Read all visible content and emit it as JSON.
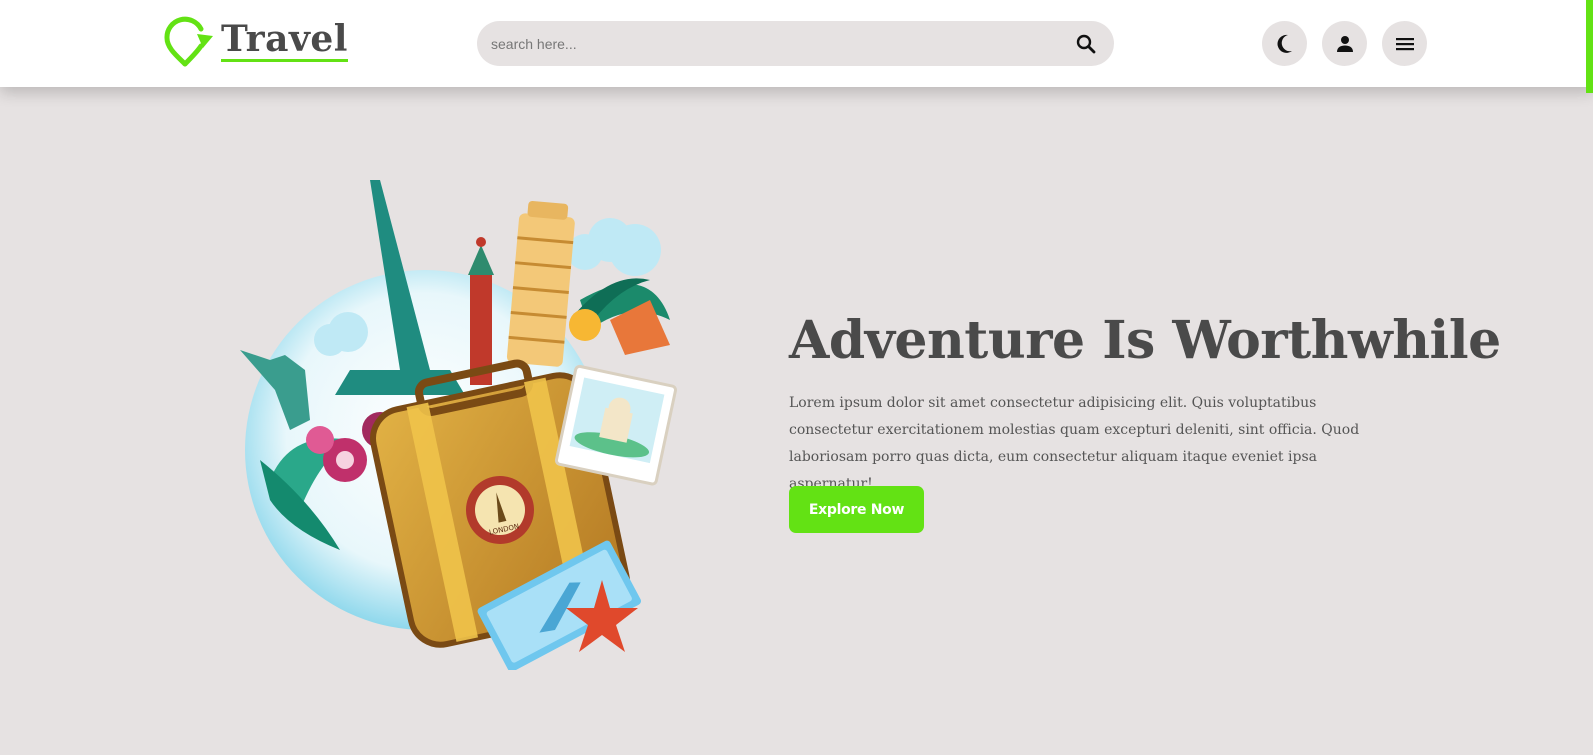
{
  "header": {
    "logo_text": "Travel",
    "search": {
      "placeholder": "search here...",
      "value": ""
    },
    "icons": [
      "moon-icon",
      "user-icon",
      "menu-icon"
    ]
  },
  "hero": {
    "title": "Adventure Is Worthwhile",
    "text": "Lorem ipsum dolor sit amet consectetur adipisicing elit. Quis voluptatibus consectetur exercitationem molestias quam excepturi deleniti, sint officia. Quod laboriosam porro quas dicta, eum consectetur aliquam itaque eveniet ipsa aspernatur!",
    "button_label": "Explore Now",
    "badge_text": "LONDON"
  },
  "colors": {
    "accent": "#63e214",
    "background": "#e6e2e2",
    "header_bg": "#ffffff",
    "heading": "#4a4a4a",
    "body_text": "#555555"
  }
}
